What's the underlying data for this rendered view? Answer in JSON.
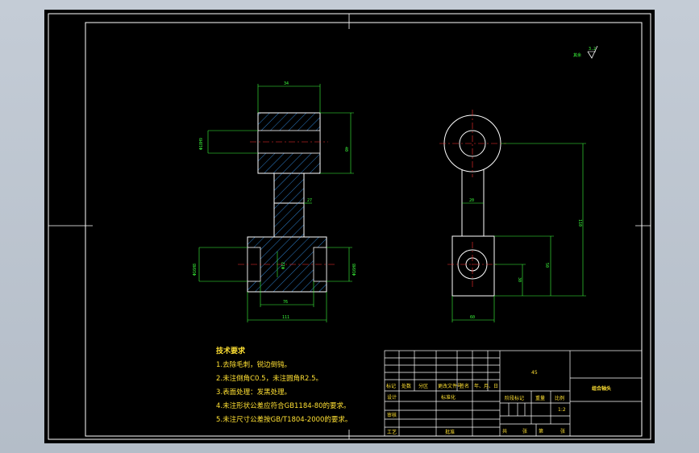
{
  "colors": {
    "background": "#000000",
    "frame": "#ffffff",
    "outline": "#ffffff",
    "dimension": "#3cff3c",
    "center_line": "#ff3030",
    "hatch": "#3aa0ff",
    "text": "#ffe033"
  },
  "roughness": {
    "value": "3.2",
    "label": "其余"
  },
  "front_view_dims": {
    "top_width": "34",
    "top_height": "40",
    "top_bore": "Φ18H9",
    "neck_width": "27",
    "bottom_outer": "111",
    "bottom_inner": "76",
    "bottom_bore_left": "Φ16H8",
    "bottom_bore_right": "Φ16H8",
    "center_bore": "Φ12"
  },
  "side_view_dims": {
    "neck": "20",
    "total_height": "110",
    "block_height": "50",
    "hole_offset": "30",
    "block_width": "60"
  },
  "tech_requirements": {
    "title": "技术要求",
    "items": [
      "1.去除毛刺，锐边倒钝。",
      "2.未注倒角C0.5，未注圆角R2.5。",
      "3.表面处理：发黑处理。",
      "4.未注形状公差应符合GB1184-80的要求。",
      "5.未注尺寸公差按GB/T1804-2000的要求。"
    ]
  },
  "title_block": {
    "material": "45",
    "part_name": "组合轴头",
    "scale": "1:2",
    "revision_headers": [
      "标记",
      "处数",
      "分区",
      "更改文件号",
      "签名",
      "年、月、日"
    ],
    "design_label": "设计",
    "standardize_label": "标准化",
    "review_label": "审核",
    "process_label": "工艺",
    "approve_label": "批准",
    "stage_label": "阶段标记",
    "weight_label": "重量",
    "scale_label": "比例",
    "total_label": "共",
    "sheet_label": "张",
    "page_label": "第",
    "page_suffix": "张"
  }
}
